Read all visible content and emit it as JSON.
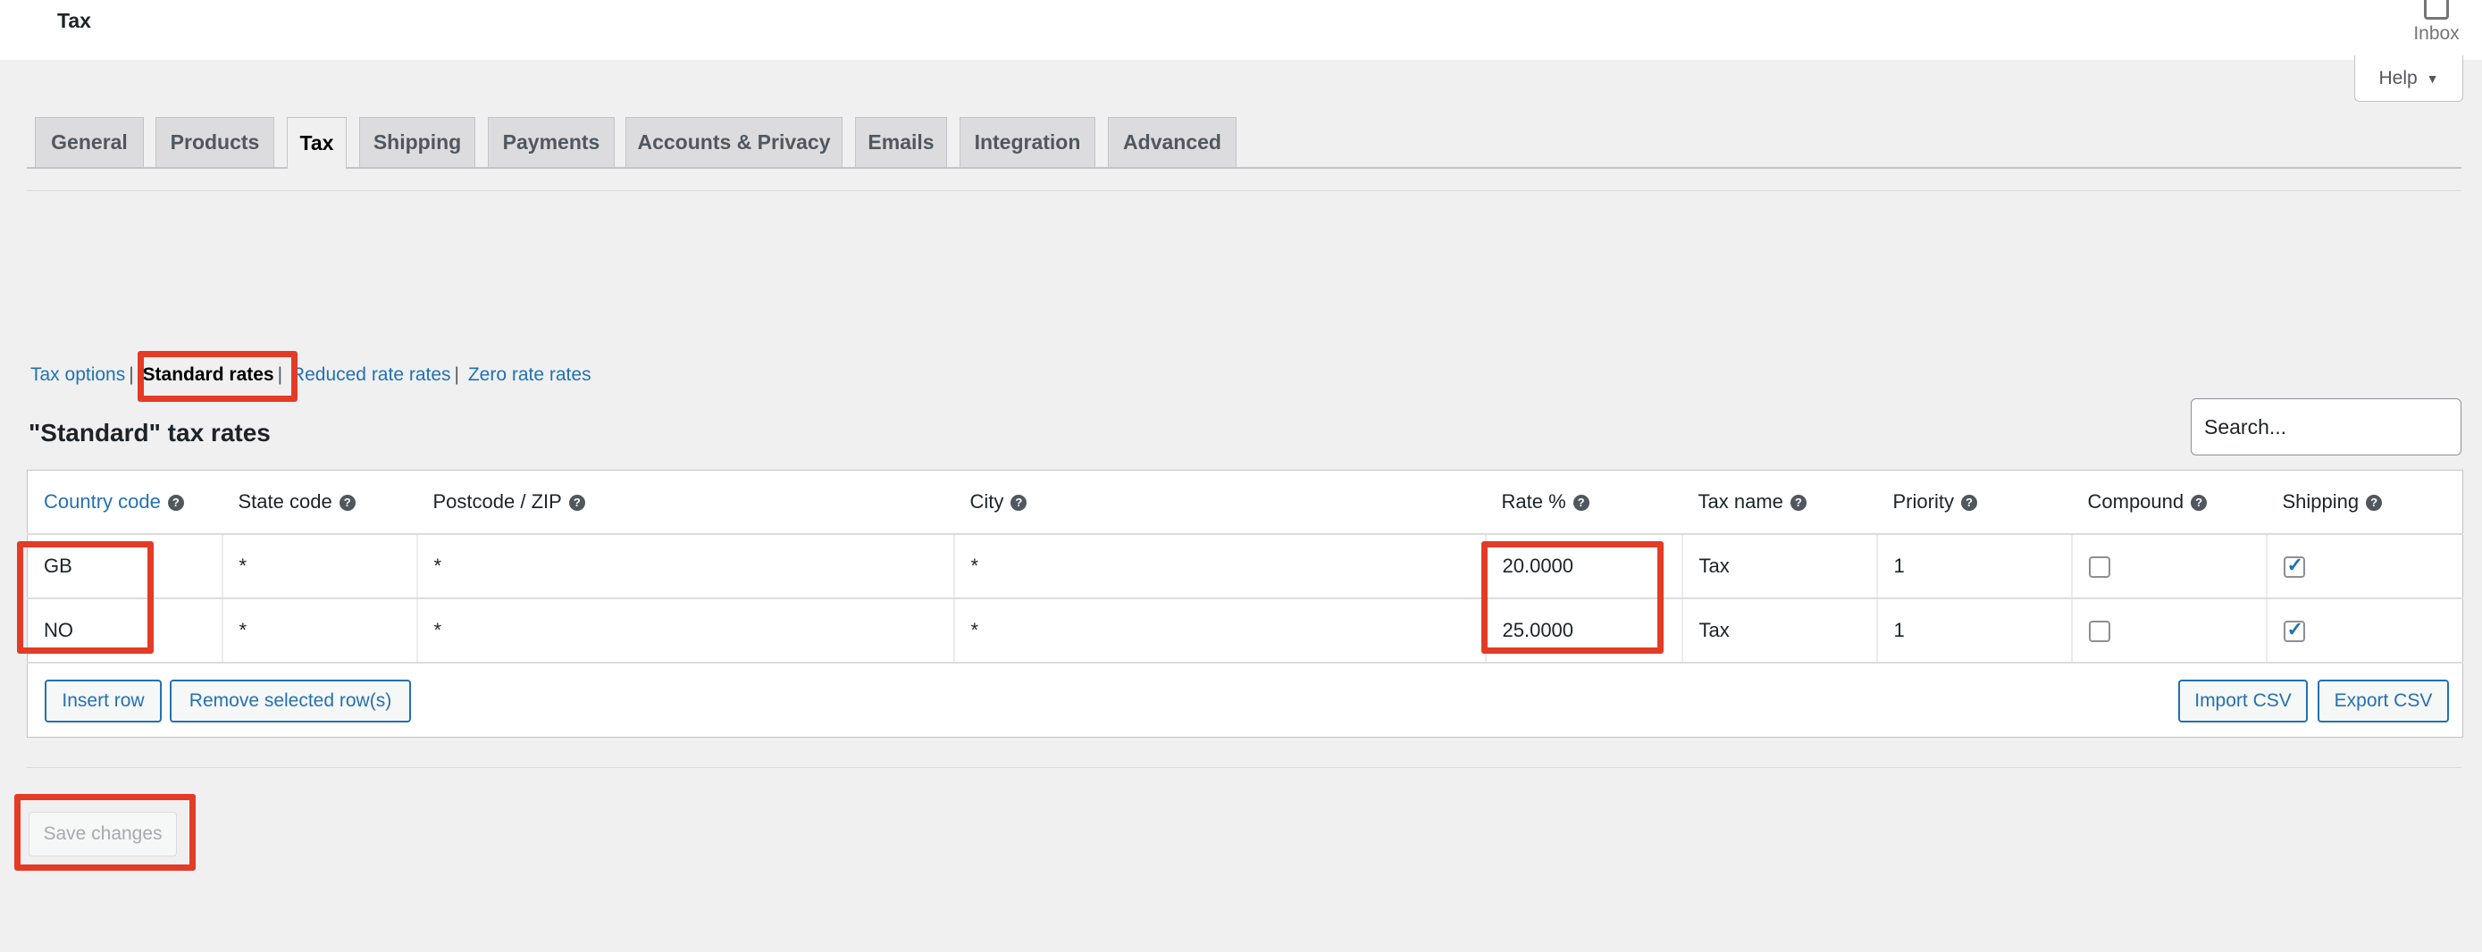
{
  "header": {
    "title": "Tax",
    "inbox_label": "Inbox",
    "help_label": "Help"
  },
  "tabs": [
    {
      "label": "General"
    },
    {
      "label": "Products"
    },
    {
      "label": "Tax",
      "active": true
    },
    {
      "label": "Shipping"
    },
    {
      "label": "Payments"
    },
    {
      "label": "Accounts & Privacy"
    },
    {
      "label": "Emails"
    },
    {
      "label": "Integration"
    },
    {
      "label": "Advanced"
    }
  ],
  "subnav": {
    "items": [
      "Tax options",
      "Standard rates",
      "Reduced rate rates",
      "Zero rate rates"
    ],
    "current": "Standard rates"
  },
  "section": {
    "heading": "\"Standard\" tax rates",
    "search_placeholder": "Search..."
  },
  "table": {
    "columns": [
      "Country code",
      "State code",
      "Postcode / ZIP",
      "City",
      "Rate %",
      "Tax name",
      "Priority",
      "Compound",
      "Shipping"
    ],
    "rows": [
      {
        "country": "GB",
        "state": "*",
        "postcode": "*",
        "city": "*",
        "rate": "20.0000",
        "name": "Tax",
        "priority": "1",
        "compound": false,
        "shipping": true
      },
      {
        "country": "NO",
        "state": "*",
        "postcode": "*",
        "city": "*",
        "rate": "25.0000",
        "name": "Tax",
        "priority": "1",
        "compound": false,
        "shipping": true
      }
    ],
    "buttons": {
      "insert": "Insert row",
      "remove": "Remove selected row(s)",
      "import": "Import CSV",
      "export": "Export CSV"
    }
  },
  "save_label": "Save changes",
  "colors": {
    "accent": "#2271b1",
    "highlight": "#e33b26"
  }
}
